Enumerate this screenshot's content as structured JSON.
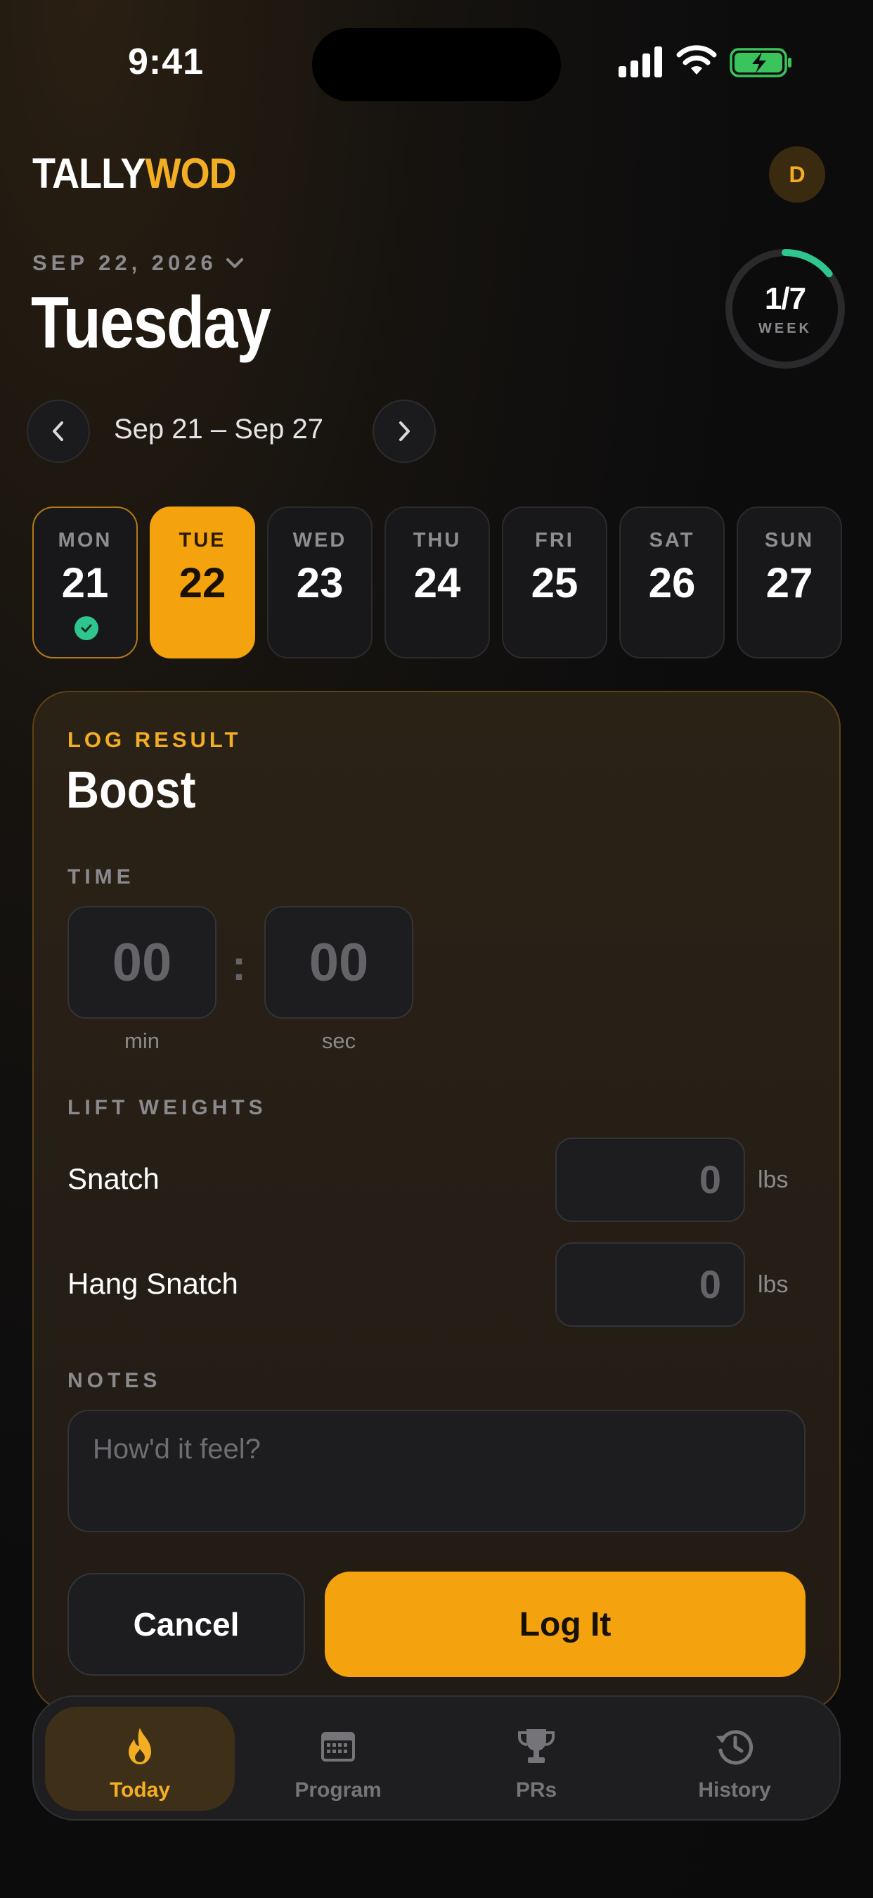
{
  "status_bar": {
    "time": "9:41"
  },
  "header": {
    "brand_part1": "TALLY",
    "brand_part2": "WOD",
    "avatar_initial": "D",
    "date": "SEP 22, 2026",
    "day": "Tuesday",
    "week_progress": {
      "value": "1/7",
      "label": "WEEK",
      "fraction": 0.143
    }
  },
  "week_nav": {
    "range": "Sep 21 – Sep 27"
  },
  "days": [
    {
      "name": "MON",
      "num": "21",
      "state": "done"
    },
    {
      "name": "TUE",
      "num": "22",
      "state": "selected"
    },
    {
      "name": "WED",
      "num": "23",
      "state": ""
    },
    {
      "name": "THU",
      "num": "24",
      "state": ""
    },
    {
      "name": "FRI",
      "num": "25",
      "state": ""
    },
    {
      "name": "SAT",
      "num": "26",
      "state": ""
    },
    {
      "name": "SUN",
      "num": "27",
      "state": ""
    }
  ],
  "log": {
    "eyebrow": "LOG RESULT",
    "title": "Boost",
    "time_label": "TIME",
    "minutes": "00",
    "seconds": "00",
    "min_unit": "min",
    "sec_unit": "sec",
    "lift_label": "LIFT WEIGHTS",
    "lifts": [
      {
        "name": "Snatch",
        "value": "0",
        "unit": "lbs"
      },
      {
        "name": "Hang Snatch",
        "value": "0",
        "unit": "lbs"
      }
    ],
    "notes_label": "NOTES",
    "notes_placeholder": "How'd it feel?",
    "cancel": "Cancel",
    "submit": "Log It"
  },
  "tabs": [
    {
      "label": "Today",
      "icon": "flame-icon",
      "active": true
    },
    {
      "label": "Program",
      "icon": "calendar-icon",
      "active": false
    },
    {
      "label": "PRs",
      "icon": "trophy-icon",
      "active": false
    },
    {
      "label": "History",
      "icon": "history-icon",
      "active": false
    }
  ],
  "colors": {
    "accent": "#f4a30f",
    "success": "#2fc58e",
    "background": "#0c0c0d"
  }
}
